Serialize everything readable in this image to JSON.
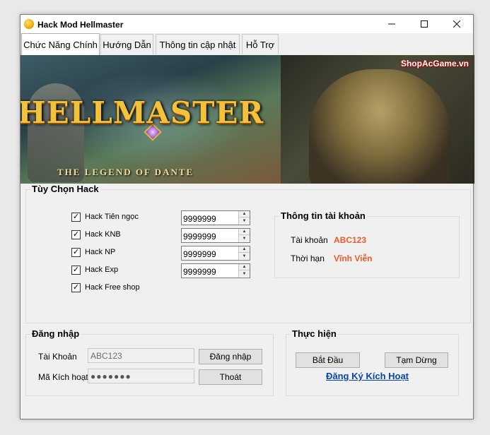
{
  "window": {
    "title": "Hack Mod Hellmaster",
    "controls": {
      "minimize": "minimize-icon",
      "maximize": "maximize-icon",
      "close": "close-icon"
    }
  },
  "tabs": [
    {
      "label": "Chức Năng Chính",
      "active": true
    },
    {
      "label": "Hướng Dẫn",
      "active": false
    },
    {
      "label": "Thông tin cập nhật",
      "active": false
    },
    {
      "label": "Hỗ Trợ",
      "active": false
    }
  ],
  "banner": {
    "logo_title": "HELLMASTER",
    "logo_subtitle": "THE LEGEND OF DANTE",
    "watermark": "ShopAcGame.vn"
  },
  "hack_options": {
    "title": "Tùy Chọn Hack",
    "items": [
      {
        "label": "Hack Tiên ngọc",
        "checked": true,
        "value": "9999999"
      },
      {
        "label": "Hack KNB",
        "checked": true,
        "value": "9999999"
      },
      {
        "label": "Hack NP",
        "checked": true,
        "value": "9999999"
      },
      {
        "label": "Hack Exp",
        "checked": true,
        "value": "9999999"
      },
      {
        "label": "Hack Free shop",
        "checked": true
      }
    ]
  },
  "account_info": {
    "title": "Thông tin tài khoản",
    "account_label": "Tài khoản",
    "account_value": "ABC123",
    "expiry_label": "Thời hạn",
    "expiry_value": "Vĩnh Viễn"
  },
  "login": {
    "title": "Đăng nhập",
    "account_label": "Tài Khoản",
    "account_value": "ABC123",
    "code_label": "Mã Kích hoạt",
    "code_value": "●●●●●●●",
    "login_button": "Đăng nhập",
    "exit_button": "Thoát"
  },
  "execute": {
    "title": "Thực hiện",
    "start_button": "Bắt Đầu",
    "pause_button": "Tạm Dừng",
    "register_link": "Đăng Ký Kích Hoạt"
  },
  "colors": {
    "accent_value": "#f05a28",
    "link": "#0645ad",
    "window_bg": "#f0f0f0"
  }
}
